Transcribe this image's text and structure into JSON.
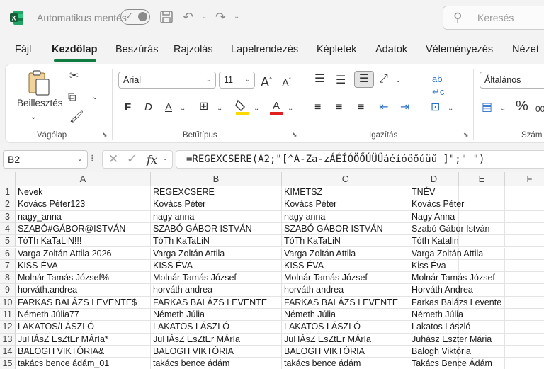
{
  "titlebar": {
    "autosave_label": "Automatikus mentés",
    "search_placeholder": "Keresés",
    "colors": {
      "excel_green": "#107c41"
    }
  },
  "tabs": [
    "Fájl",
    "Kezdőlap",
    "Beszúrás",
    "Rajzolás",
    "Lapelrendezés",
    "Képletek",
    "Adatok",
    "Véleményezés",
    "Nézet"
  ],
  "active_tab": "Kezdőlap",
  "ribbon": {
    "groups": {
      "clipboard": "Vágólap",
      "font": "Betűtípus",
      "alignment": "Igazítás",
      "number": "Szám"
    },
    "paste_label": "Beillesztés",
    "font_name": "Arial",
    "font_size": "11",
    "bold": "F",
    "italic": "D",
    "underline": "A",
    "number_format": "Általános",
    "font_color": "#e02020",
    "fill_color": "#ffd800"
  },
  "formula_bar": {
    "name_box": "B2",
    "formula": "=REGEXCSERE(A2;\"[^A-Za-zÁÉÍÓÖŐÚÜŰáéíóöőúüű ]\";\" \")"
  },
  "columns": [
    "A",
    "B",
    "C",
    "D",
    "E",
    "F"
  ],
  "rows": [
    [
      "Nevek",
      "REGEXCSERE",
      "KIMETSZ",
      "TNÉV"
    ],
    [
      "Kovács Péter123",
      "Kovács Péter",
      "Kovács Péter",
      "Kovács Péter"
    ],
    [
      "nagy_anna",
      "nagy anna",
      "nagy anna",
      "Nagy Anna"
    ],
    [
      "SZABÓ#GÁBOR@ISTVÁN",
      "SZABÓ GÁBOR ISTVÁN",
      "SZABÓ GÁBOR ISTVÁN",
      "Szabó Gábor István"
    ],
    [
      "TóTh KaTaLiN!!!",
      "TóTh KaTaLiN",
      "TóTh KaTaLiN",
      "Tóth Katalin"
    ],
    [
      "Varga Zoltán Attila 2026",
      "Varga Zoltán Attila",
      "Varga Zoltán Attila",
      "Varga Zoltán Attila"
    ],
    [
      "KISS-ÉVA",
      "KISS ÉVA",
      "KISS ÉVA",
      "Kiss Éva"
    ],
    [
      "Molnár Tamás József%",
      "Molnár Tamás József",
      "Molnár Tamás József",
      "Molnár Tamás József"
    ],
    [
      "horváth.andrea",
      "horváth andrea",
      "horváth andrea",
      "Horváth Andrea"
    ],
    [
      "FARKAS BALÁZS LEVENTE$",
      "FARKAS BALÁZS LEVENTE",
      "FARKAS BALÁZS LEVENTE",
      "Farkas Balázs Levente"
    ],
    [
      "Németh Júlia77",
      "Németh Júlia",
      "Németh Júlia",
      "Németh Júlia"
    ],
    [
      "LAKATOS/LÁSZLÓ",
      "LAKATOS LÁSZLÓ",
      "LAKATOS LÁSZLÓ",
      "Lakatos László"
    ],
    [
      "JuHÁsZ EsZtEr MÁrIa*",
      "JuHÁsZ EsZtEr MÁrIa",
      "JuHÁsZ EsZtEr MÁrIa",
      "Juhász Eszter Mária"
    ],
    [
      "BALOGH VIKTÓRIA&",
      "BALOGH VIKTÓRIA",
      "BALOGH VIKTÓRIA",
      "Balogh Viktória"
    ],
    [
      "takács bence ádám_01",
      "takács bence ádám",
      "takács bence ádám",
      "Takács Bence Ádám"
    ]
  ]
}
